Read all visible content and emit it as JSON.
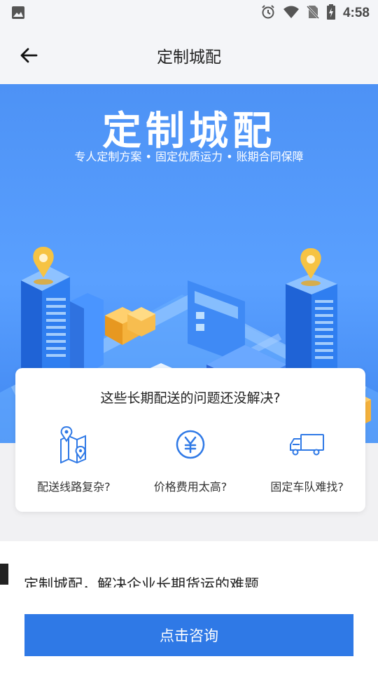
{
  "status_bar": {
    "time": "4:58",
    "icons": [
      "image-icon",
      "alarm-icon",
      "wifi-icon",
      "no-sim-icon",
      "battery-charging-icon"
    ]
  },
  "app_bar": {
    "back_icon": "arrow-left-icon",
    "title": "定制城配"
  },
  "hero": {
    "title": "定制城配",
    "subtitle": "专人定制方案 • 固定优质运力 • 账期合同保障"
  },
  "card": {
    "question": "这些长期配送的问题还没解决?",
    "items": [
      {
        "icon": "map-route-icon",
        "label": "配送线路复杂?"
      },
      {
        "icon": "yuan-icon",
        "label": "价格费用太高?"
      },
      {
        "icon": "truck-icon",
        "label": "固定车队难找?"
      }
    ]
  },
  "section": {
    "heading": "定制城配，解决企业长期货运的难题"
  },
  "cta": {
    "label": "点击咨询"
  },
  "colors": {
    "accent": "#2f79e6",
    "hero_blue": "#4d92f5",
    "pin_yellow": "#f6c343"
  }
}
